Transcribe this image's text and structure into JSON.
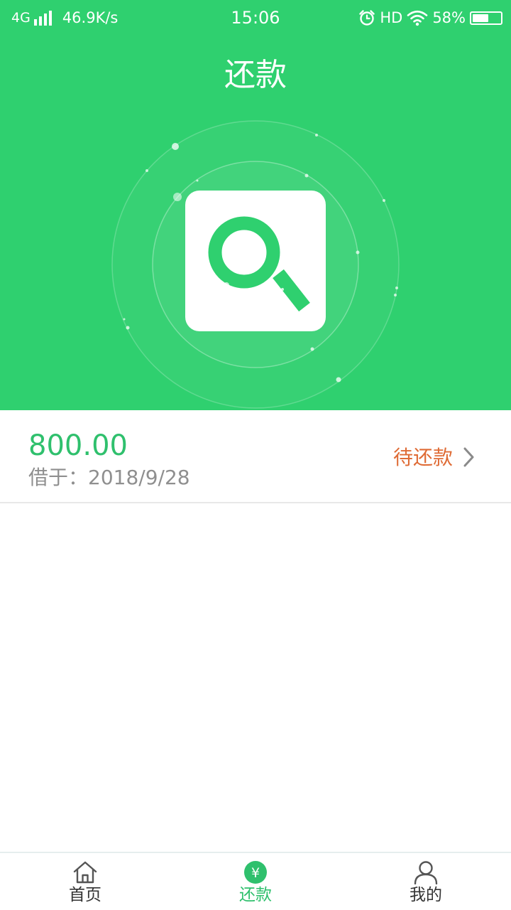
{
  "status_bar": {
    "network": "4G",
    "speed": "46.9K/s",
    "time": "15:06",
    "hd": "HD",
    "battery_text": "58%",
    "battery_level": 0.58,
    "icons": [
      "signal-icon",
      "alarm-icon",
      "wifi-icon",
      "battery-icon"
    ]
  },
  "header": {
    "title": "还款",
    "background_color": "#2fd06f",
    "hero_icon": "search-icon"
  },
  "loan": {
    "amount": "800.00",
    "borrow_label": "借于：",
    "borrow_date": "2018/9/28",
    "status": "待还款",
    "amount_color": "#2fc06d",
    "status_color": "#df6b35"
  },
  "tabs": [
    {
      "label": "首页",
      "icon": "home-icon",
      "active": false
    },
    {
      "label": "还款",
      "icon": "yuan-icon",
      "active": true
    },
    {
      "label": "我的",
      "icon": "user-icon",
      "active": false
    }
  ],
  "accent_color": "#2fc06d"
}
